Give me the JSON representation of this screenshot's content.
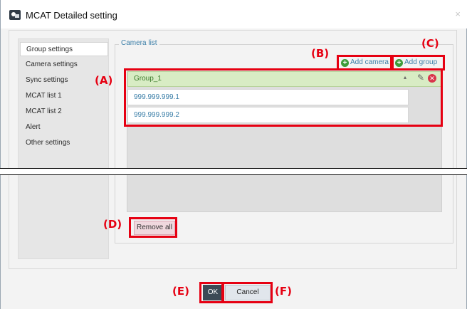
{
  "window": {
    "title": "MCAT Detailed setting",
    "close_glyph": "×"
  },
  "sidebar": {
    "items": [
      {
        "label": "Group settings",
        "active": true
      },
      {
        "label": "Camera settings",
        "active": false
      },
      {
        "label": "Sync settings",
        "active": false
      },
      {
        "label": "MCAT list 1",
        "active": false
      },
      {
        "label": "MCAT list 2",
        "active": false
      },
      {
        "label": "Alert",
        "active": false
      },
      {
        "label": "Other settings",
        "active": false
      }
    ]
  },
  "camera_list": {
    "legend": "Camera list",
    "add_camera_label": "Add camera",
    "add_group_label": "Add group",
    "plus_glyph": "+",
    "groups": [
      {
        "name": "Group_1",
        "caret_glyph": "▴",
        "edit_glyph": "✎",
        "delete_glyph": "✕",
        "cameras": [
          "999.999.999.1",
          "999.999.999.2"
        ]
      }
    ],
    "remove_all_label": "Remove all"
  },
  "footer": {
    "ok_label": "OK",
    "cancel_label": "Cancel"
  },
  "annotations": {
    "A": "(A)",
    "B": "(B)",
    "C": "(C)",
    "D": "(D)",
    "E": "(E)",
    "F": "(F)"
  },
  "colors": {
    "annotation_red": "#e60012",
    "group_row_green": "#d8ecc4",
    "link_blue": "#3c7fa8",
    "add_icon_green": "#3d9c3a",
    "delete_icon_red": "#d9354b",
    "ok_button_dark": "#3c4a56"
  }
}
